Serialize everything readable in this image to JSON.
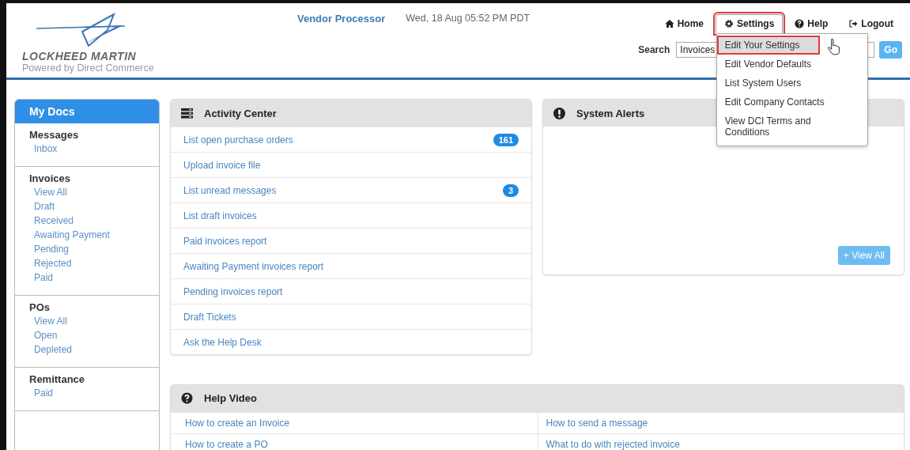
{
  "header": {
    "brand": "LOCKHEED MARTIN",
    "tagline": "Powered by Direct Commerce",
    "app_title": "Vendor Processor",
    "datetime": "Wed, 18 Aug 05:52 PM PDT"
  },
  "nav": [
    {
      "kind": "home",
      "label": "Home",
      "open": false,
      "highlighted": false
    },
    {
      "kind": "settings",
      "label": "Settings",
      "open": true,
      "highlighted": true
    },
    {
      "kind": "help",
      "label": "Help",
      "open": false,
      "highlighted": false
    },
    {
      "kind": "logout",
      "label": "Logout",
      "open": false,
      "highlighted": false
    }
  ],
  "settings_menu": [
    {
      "label": "Edit Your Settings",
      "selected": true,
      "highlighted": true
    },
    {
      "label": "Edit Vendor Defaults",
      "selected": false,
      "highlighted": false
    },
    {
      "label": "List System Users",
      "selected": false,
      "highlighted": false
    },
    {
      "label": "Edit Company Contacts",
      "selected": false,
      "highlighted": false
    },
    {
      "label": "View DCI Terms and Conditions",
      "selected": false,
      "highlighted": false
    }
  ],
  "search": {
    "label": "Search",
    "scope": "Invoices",
    "button": "Go"
  },
  "sidebar": {
    "title": "My Docs",
    "sections": [
      {
        "heading": "Messages",
        "links": [
          "Inbox"
        ]
      },
      {
        "heading": "Invoices",
        "links": [
          "View All",
          "Draft",
          "Received",
          "Awaiting Payment",
          "Pending",
          "Rejected",
          "Paid"
        ]
      },
      {
        "heading": "POs",
        "links": [
          "View All",
          "Open",
          "Depleted"
        ]
      },
      {
        "heading": "Remittance",
        "links": [
          "Paid"
        ]
      }
    ]
  },
  "activity_center": {
    "title": "Activity Center",
    "items": [
      {
        "label": "List open purchase orders",
        "count": "161"
      },
      {
        "label": "Upload invoice file"
      },
      {
        "label": "List unread messages",
        "count": "3"
      },
      {
        "label": "List draft invoices"
      },
      {
        "label": "Paid invoices report"
      },
      {
        "label": "Awaiting Payment invoices report"
      },
      {
        "label": "Pending invoices report"
      },
      {
        "label": "Draft Tickets"
      },
      {
        "label": "Ask the Help Desk"
      }
    ]
  },
  "system_alerts": {
    "title": "System Alerts",
    "button": "+ View All"
  },
  "help_video": {
    "title": "Help Video",
    "links": [
      "How to create an Invoice",
      "How to send a message",
      "How to create a PO",
      "What to do with rejected invoice"
    ]
  }
}
